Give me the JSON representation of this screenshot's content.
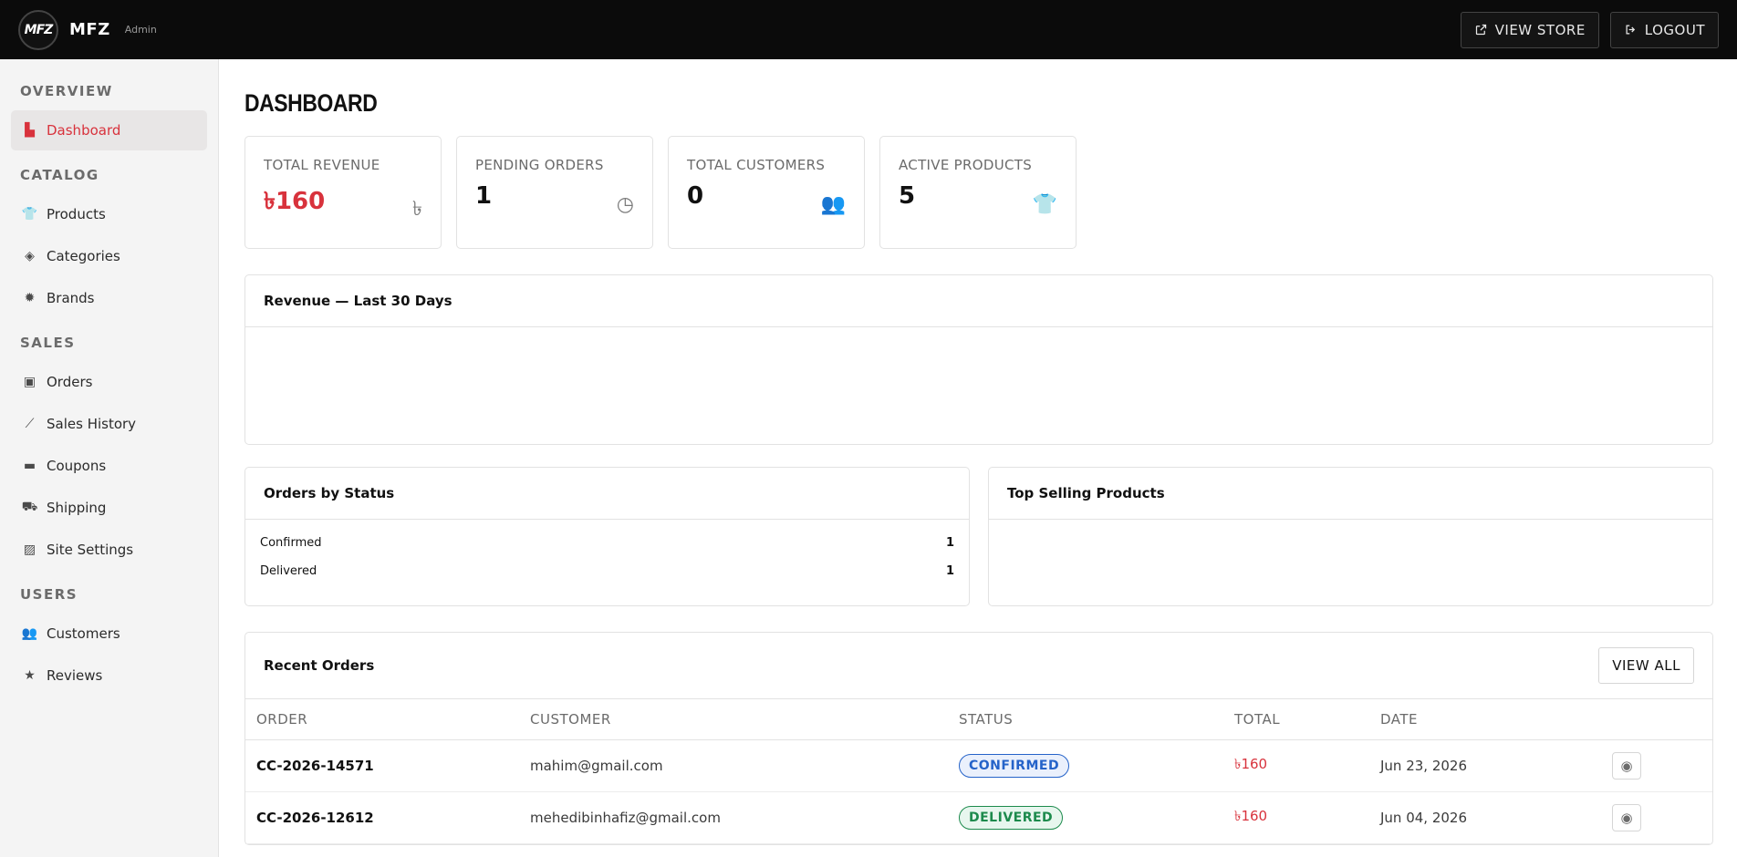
{
  "app": {
    "logo_text": "MFZ",
    "brand": "MFZ",
    "subtitle": "Admin"
  },
  "topbar": {
    "view_store": "VIEW STORE",
    "logout": "LOGOUT"
  },
  "sidebar": {
    "sections": [
      {
        "title": "OVERVIEW",
        "items": [
          {
            "label": "Dashboard",
            "icon": "chart-icon",
            "active": true
          }
        ]
      },
      {
        "title": "CATALOG",
        "items": [
          {
            "label": "Products",
            "icon": "tshirt-icon"
          },
          {
            "label": "Categories",
            "icon": "tags-icon"
          },
          {
            "label": "Brands",
            "icon": "badge-icon"
          }
        ]
      },
      {
        "title": "SALES",
        "items": [
          {
            "label": "Orders",
            "icon": "box-icon"
          },
          {
            "label": "Sales History",
            "icon": "line-chart-icon"
          },
          {
            "label": "Coupons",
            "icon": "ticket-icon"
          },
          {
            "label": "Shipping",
            "icon": "truck-icon"
          },
          {
            "label": "Site Settings",
            "icon": "image-icon"
          }
        ]
      },
      {
        "title": "USERS",
        "items": [
          {
            "label": "Customers",
            "icon": "users-icon"
          },
          {
            "label": "Reviews",
            "icon": "star-icon"
          }
        ]
      }
    ]
  },
  "main": {
    "title": "DASHBOARD",
    "stats": [
      {
        "label": "TOTAL REVENUE",
        "value": "৳160",
        "icon": "taka-icon"
      },
      {
        "label": "PENDING ORDERS",
        "value": "1",
        "icon": "clock-icon"
      },
      {
        "label": "TOTAL CUSTOMERS",
        "value": "0",
        "icon": "users-icon"
      },
      {
        "label": "ACTIVE PRODUCTS",
        "value": "5",
        "icon": "tshirt-icon"
      }
    ],
    "revenue_title": "Revenue — Last 30 Days",
    "orders_by_status": {
      "title": "Orders by Status",
      "rows": [
        {
          "label": "Confirmed",
          "count": "1"
        },
        {
          "label": "Delivered",
          "count": "1"
        }
      ]
    },
    "top_selling_title": "Top Selling Products",
    "recent": {
      "title": "Recent Orders",
      "view_all": "VIEW ALL",
      "headers": [
        "ORDER",
        "CUSTOMER",
        "STATUS",
        "TOTAL",
        "DATE"
      ],
      "rows": [
        {
          "order": "CC-2026-14571",
          "customer": "mahim@gmail.com",
          "status": "CONFIRMED",
          "total": "৳160",
          "date": "Jun 23, 2026"
        },
        {
          "order": "CC-2026-12612",
          "customer": "mehedibinhafiz@gmail.com",
          "status": "DELIVERED",
          "total": "৳160",
          "date": "Jun 04, 2026"
        }
      ]
    }
  },
  "colors": {
    "accent": "#d8323c",
    "topbar": "#0b0b0b",
    "confirmed": "#2563c9",
    "delivered": "#1c8a4c"
  }
}
